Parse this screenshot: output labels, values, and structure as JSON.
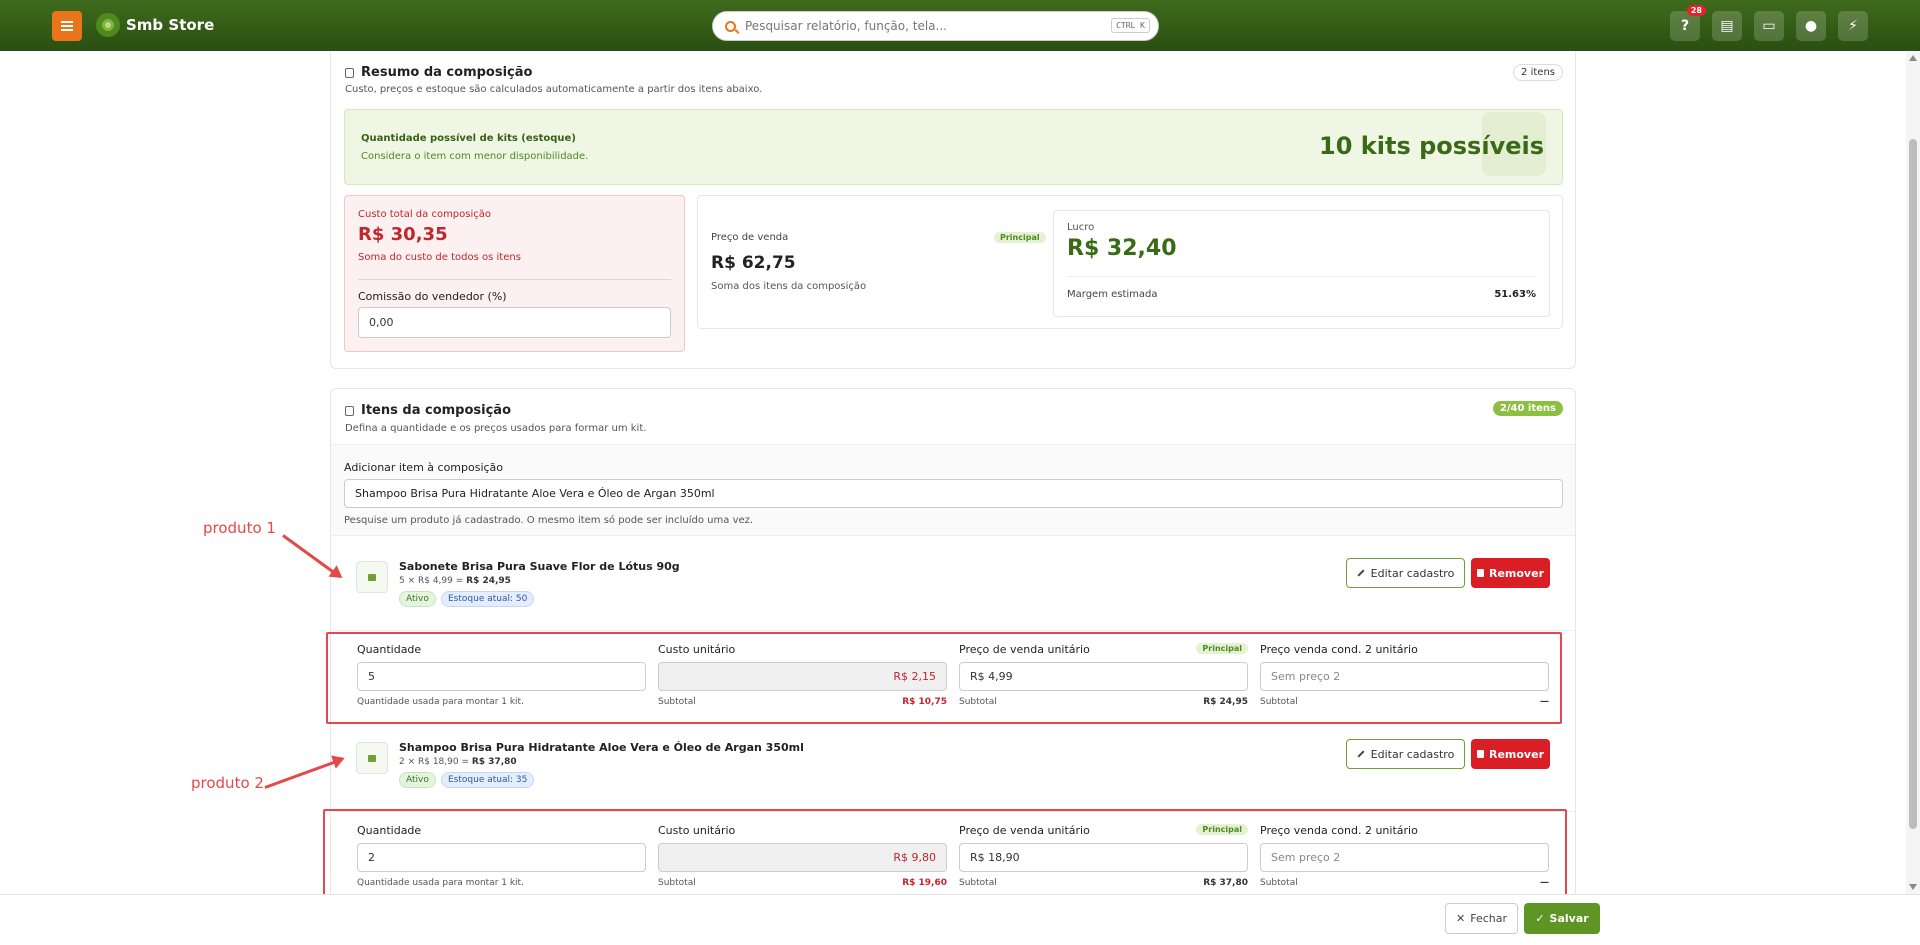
{
  "header": {
    "brand": "Smb Store",
    "search_placeholder": "Pesquisar relatório, função, tela...",
    "shortcut": "CTRL K",
    "help_badge": "28",
    "icons": [
      "help-icon",
      "cart-icon",
      "monitor-icon",
      "chat-icon",
      "lightning-icon"
    ]
  },
  "summary": {
    "title": "Resumo da composição",
    "subtitle": "Custo, preços e estoque são calculados automaticamente a partir dos itens abaixo.",
    "items_badge": "2 itens",
    "kits_label": "Quantidade possível de kits (estoque)",
    "kits_sub": "Considera o item com menor disponibilidade.",
    "kits_value": "10 kits possíveis",
    "cost_label": "Custo total da composição",
    "cost_value": "R$ 30,35",
    "cost_sub": "Soma do custo de todos os itens",
    "commission_label": "Comissão do vendedor (%)",
    "commission_value": "0,00",
    "price_label": "Preço de venda",
    "price_badge": "Principal",
    "price_value": "R$ 62,75",
    "price_sub": "Soma dos itens da composição",
    "profit_label": "Lucro",
    "profit_value": "R$ 32,40",
    "margin_label": "Margem estimada",
    "margin_value": "51.63%"
  },
  "items_section": {
    "title": "Itens da composição",
    "subtitle": "Defina a quantidade e os preços usados para formar um kit.",
    "count_badge": "2/40 itens",
    "add_label": "Adicionar item à composição",
    "add_value": "Shampoo Brisa Pura Hidratante Aloe Vera e Óleo de Argan 350ml",
    "add_hint": "Pesquise um produto já cadastrado. O mesmo item só pode ser incluído uma vez.",
    "edit_label": "Editar cadastro",
    "remove_label": "Remover",
    "qty_label": "Quantidade",
    "qty_hint": "Quantidade usada para montar 1 kit.",
    "unit_cost_label": "Custo unitário",
    "subtotal_label": "Subtotal",
    "unit_price_label": "Preço de venda unitário",
    "principal_badge": "Principal",
    "cond2_label": "Preço venda cond. 2 unitário",
    "cond2_placeholder": "Sem preço 2",
    "cond2_subtotal": "—",
    "status_active": "Ativo",
    "items": [
      {
        "name": "Sabonete Brisa Pura Suave Flor de Lótus 90g",
        "calc_prefix": "5 × R$ 4,99 = ",
        "calc_total": "R$ 24,95",
        "stock": "Estoque atual: 50",
        "qty": "5",
        "unit_cost": "R$ 2,15",
        "cost_subtotal": "R$ 10,75",
        "unit_price": "R$ 4,99",
        "price_subtotal": "R$ 24,95"
      },
      {
        "name": "Shampoo Brisa Pura Hidratante Aloe Vera e Óleo de Argan 350ml",
        "calc_prefix": "2 × R$ 18,90 = ",
        "calc_total": "R$ 37,80",
        "stock": "Estoque atual: 35",
        "qty": "2",
        "unit_cost": "R$ 9,80",
        "cost_subtotal": "R$ 19,60",
        "unit_price": "R$ 18,90",
        "price_subtotal": "R$ 37,80"
      }
    ]
  },
  "annotations": {
    "label_1": "produto 1",
    "label_2": "produto 2",
    "color": "#e54848"
  },
  "footer": {
    "close_label": "Fechar",
    "save_label": "Salvar"
  },
  "colors": {
    "header_green": "#2f5512",
    "accent_orange": "#e8741c",
    "danger_red": "#d91e26",
    "success_green": "#5e9524"
  }
}
